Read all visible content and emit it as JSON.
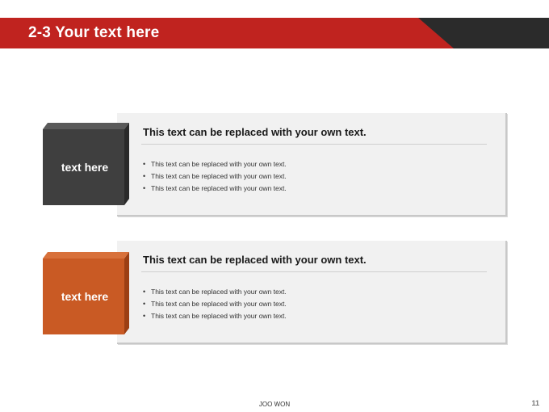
{
  "header": {
    "title": "2-3 Your text here",
    "colors": {
      "red": "#c0231f",
      "dark": "#2b2b2b"
    }
  },
  "sections": [
    {
      "label": "text here",
      "label_color": "#3f3f3f",
      "heading": "This text can be replaced with your own text.",
      "bullets": [
        "This text can be replaced with your own text.",
        "This text can be replaced with your own text.",
        "This text can be replaced with your own text."
      ]
    },
    {
      "label": "text here",
      "label_color": "#c95a24",
      "heading": "This text can be replaced with your own text.",
      "bullets": [
        "This text can be replaced with your own text.",
        "This text can be replaced with your own text.",
        "This text can be replaced with your own text."
      ]
    }
  ],
  "footer": {
    "center_text": "JOO WON",
    "page_number": "11"
  }
}
